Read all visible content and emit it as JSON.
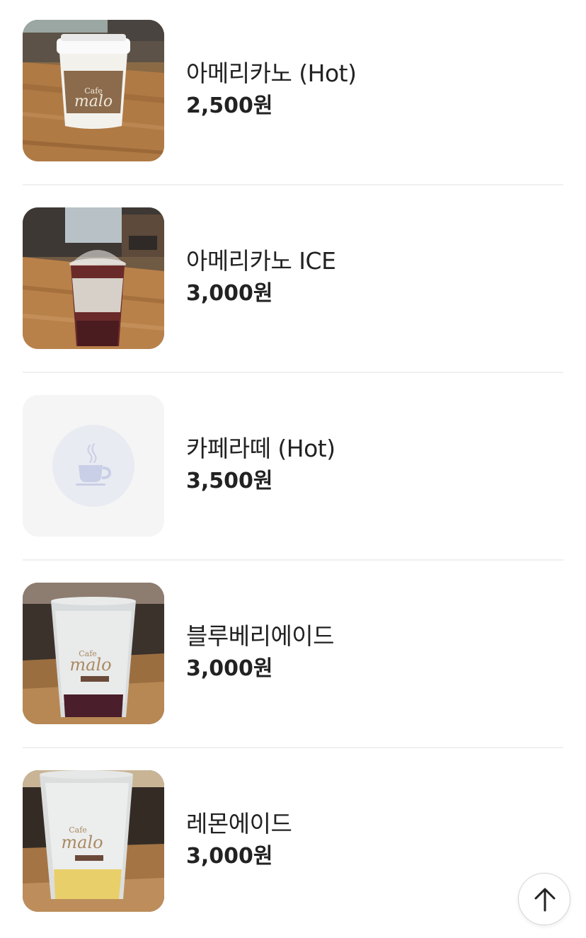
{
  "menu": {
    "items": [
      {
        "name": "아메리카노 (Hot)",
        "price": "2,500원",
        "image": "hot-americano-cup-photo"
      },
      {
        "name": "아메리카노 ICE",
        "price": "3,000원",
        "image": "iced-americano-cup-photo"
      },
      {
        "name": "카페라떼 (Hot)",
        "price": "3,500원",
        "image": "coffee-cup-placeholder-icon"
      },
      {
        "name": "블루베리에이드",
        "price": "3,000원",
        "image": "blueberry-ade-cup-photo"
      },
      {
        "name": "레몬에이드",
        "price": "3,000원",
        "image": "lemon-ade-cup-photo"
      }
    ]
  },
  "scroll_top": {
    "icon": "arrow-up-icon"
  },
  "colors": {
    "text": "#222222",
    "divider": "#f0f0f0",
    "placeholder_bg": "#f5f5f6",
    "placeholder_circle": "#e9ebf2",
    "placeholder_icon": "#c9cfe6"
  }
}
